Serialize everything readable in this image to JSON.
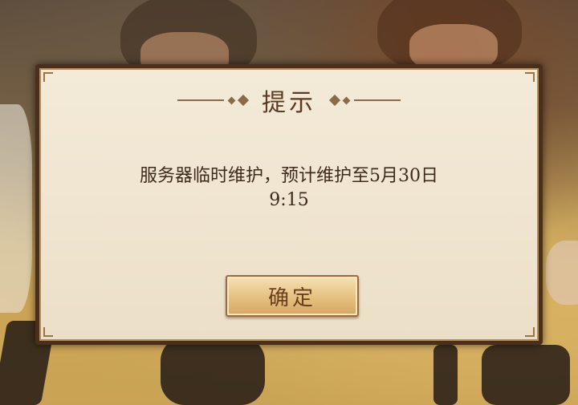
{
  "dialog": {
    "title": "提示",
    "message_line1": "服务器临时维护，预计维护至5月30日",
    "message_line2": "9:15",
    "confirm_label": "确定"
  },
  "colors": {
    "dialog_border": "#4a2f1c",
    "dialog_bg": "#f3ead8",
    "title_text": "#5a3a22",
    "button_bg": "#e7c384",
    "button_text": "#6a3e1e"
  },
  "icons": {
    "title_ornaments": "diamond-ornament-icon"
  }
}
